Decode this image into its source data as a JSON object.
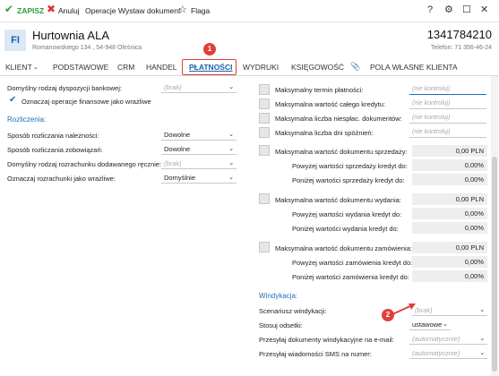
{
  "toolbar": {
    "save": "ZAPISZ",
    "cancel": "Anuluj",
    "operations": "Operacje",
    "issue_document": "Wystaw dokument",
    "flag": "Flaga"
  },
  "header": {
    "initials": "FI",
    "company": "Hurtownia ALA",
    "address": "Romanowskiego 134 , 54-948 Oleśnica",
    "nip": "1341784210",
    "phone": "Telefon: 71 356-46-24"
  },
  "tabs": [
    "KLIENT",
    "PODSTAWOWE",
    "CRM",
    "HANDEL",
    "PŁATNOŚCI",
    "WYDRUKI",
    "KSIĘGOWOŚĆ",
    "POLA WŁASNE KLIENTA"
  ],
  "markers": {
    "one": "1",
    "two": "2"
  },
  "left": {
    "disposition_label": "Domyślny rodzaj dyspozycji bankowej:",
    "disposition_value": "(brak)",
    "sensitive_label": "Oznaczaj operacje finansowe jako wrażliwe",
    "settlements_title": "Rozliczenia:",
    "rows": [
      {
        "label": "Sposób rozliczania należności:",
        "value": "Dowolne",
        "placeholder": false
      },
      {
        "label": "Sposób rozliczania zobowiązań:",
        "value": "Dowolne",
        "placeholder": false
      },
      {
        "label": "Domyślny rodzaj rozrachunku dodawanego ręcznie:",
        "value": "(brak)",
        "placeholder": true
      },
      {
        "label": "Oznaczaj rozrachunki jako wrażliwe:",
        "value": "Domyślnie",
        "placeholder": false
      }
    ]
  },
  "right": {
    "limits": [
      {
        "label": "Maksymalny termin płatności:",
        "value": "(nie kontroluj)"
      },
      {
        "label": "Maksymalna wartość całego kredytu:",
        "value": "(nie kontroluj)"
      },
      {
        "label": "Maksymalna liczba niespłac. dokumentów:",
        "value": "(nie kontroluj)"
      },
      {
        "label": "Maksymalna liczba dni spóźnień:",
        "value": "(nie kontroluj)"
      }
    ],
    "sales_label": "Maksymalna wartość dokumentu sprzedaży:",
    "sales_value": "0,00 PLN",
    "sales_above_label": "Powyżej wartości sprzedaży kredyt do:",
    "sales_above_value": "0,00%",
    "sales_below_label": "Poniżej wartości sprzedaży kredyt do:",
    "sales_below_value": "0,00%",
    "issue_label": "Maksymalna wartość dokumentu wydania:",
    "issue_value": "0,00 PLN",
    "issue_above_label": "Powyżej wartości wydania kredyt do:",
    "issue_above_value": "0,00%",
    "issue_below_label": "Poniżej wartości wydania kredyt do:",
    "issue_below_value": "0,00%",
    "order_label": "Maksymalna wartość dokumentu zamówienia:",
    "order_value": "0,00 PLN",
    "order_above_label": "Powyżej wartości zamówienia kredyt do:",
    "order_above_value": "0,00%",
    "order_below_label": "Poniżej wartości zamówienia kredyt do:",
    "order_below_value": "0,00%",
    "collection_title": "Windykacja:",
    "scenario_label": "Scenariusz windykacji:",
    "scenario_value": "(brak)",
    "interest_label": "Stosuj odsetki:",
    "interest_value": "ustawowe",
    "email_label": "Przesyłaj dokumenty windykacyjne na e-mail:",
    "email_value": "(automatycznie)",
    "sms_label": "Przesyłaj wiadomości SMS na numer:",
    "sms_value": "(automatycznie)"
  },
  "colors": {
    "accent": "#1e6fb8",
    "marker": "#e0403a",
    "save_green": "#2e9e3e"
  }
}
